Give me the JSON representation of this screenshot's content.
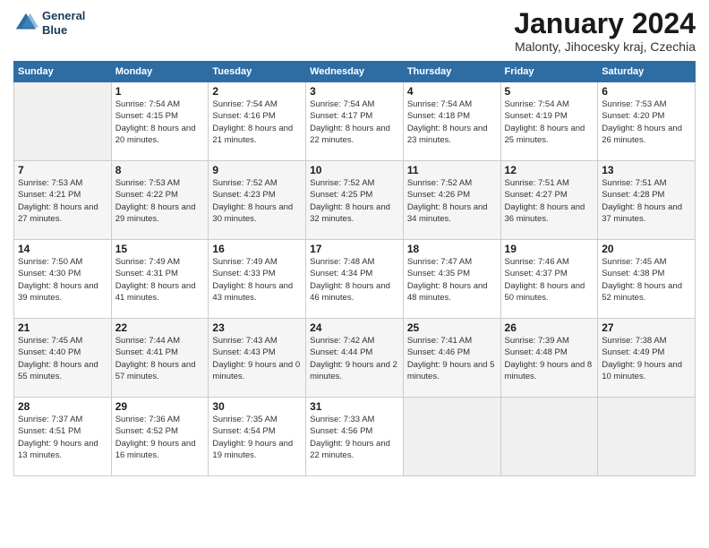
{
  "header": {
    "logo_line1": "General",
    "logo_line2": "Blue",
    "month": "January 2024",
    "location": "Malonty, Jihocesky kraj, Czechia"
  },
  "days_of_week": [
    "Sunday",
    "Monday",
    "Tuesday",
    "Wednesday",
    "Thursday",
    "Friday",
    "Saturday"
  ],
  "weeks": [
    [
      {
        "day": "",
        "sunrise": "",
        "sunset": "",
        "daylight": ""
      },
      {
        "day": "1",
        "sunrise": "Sunrise: 7:54 AM",
        "sunset": "Sunset: 4:15 PM",
        "daylight": "Daylight: 8 hours and 20 minutes."
      },
      {
        "day": "2",
        "sunrise": "Sunrise: 7:54 AM",
        "sunset": "Sunset: 4:16 PM",
        "daylight": "Daylight: 8 hours and 21 minutes."
      },
      {
        "day": "3",
        "sunrise": "Sunrise: 7:54 AM",
        "sunset": "Sunset: 4:17 PM",
        "daylight": "Daylight: 8 hours and 22 minutes."
      },
      {
        "day": "4",
        "sunrise": "Sunrise: 7:54 AM",
        "sunset": "Sunset: 4:18 PM",
        "daylight": "Daylight: 8 hours and 23 minutes."
      },
      {
        "day": "5",
        "sunrise": "Sunrise: 7:54 AM",
        "sunset": "Sunset: 4:19 PM",
        "daylight": "Daylight: 8 hours and 25 minutes."
      },
      {
        "day": "6",
        "sunrise": "Sunrise: 7:53 AM",
        "sunset": "Sunset: 4:20 PM",
        "daylight": "Daylight: 8 hours and 26 minutes."
      }
    ],
    [
      {
        "day": "7",
        "sunrise": "Sunrise: 7:53 AM",
        "sunset": "Sunset: 4:21 PM",
        "daylight": "Daylight: 8 hours and 27 minutes."
      },
      {
        "day": "8",
        "sunrise": "Sunrise: 7:53 AM",
        "sunset": "Sunset: 4:22 PM",
        "daylight": "Daylight: 8 hours and 29 minutes."
      },
      {
        "day": "9",
        "sunrise": "Sunrise: 7:52 AM",
        "sunset": "Sunset: 4:23 PM",
        "daylight": "Daylight: 8 hours and 30 minutes."
      },
      {
        "day": "10",
        "sunrise": "Sunrise: 7:52 AM",
        "sunset": "Sunset: 4:25 PM",
        "daylight": "Daylight: 8 hours and 32 minutes."
      },
      {
        "day": "11",
        "sunrise": "Sunrise: 7:52 AM",
        "sunset": "Sunset: 4:26 PM",
        "daylight": "Daylight: 8 hours and 34 minutes."
      },
      {
        "day": "12",
        "sunrise": "Sunrise: 7:51 AM",
        "sunset": "Sunset: 4:27 PM",
        "daylight": "Daylight: 8 hours and 36 minutes."
      },
      {
        "day": "13",
        "sunrise": "Sunrise: 7:51 AM",
        "sunset": "Sunset: 4:28 PM",
        "daylight": "Daylight: 8 hours and 37 minutes."
      }
    ],
    [
      {
        "day": "14",
        "sunrise": "Sunrise: 7:50 AM",
        "sunset": "Sunset: 4:30 PM",
        "daylight": "Daylight: 8 hours and 39 minutes."
      },
      {
        "day": "15",
        "sunrise": "Sunrise: 7:49 AM",
        "sunset": "Sunset: 4:31 PM",
        "daylight": "Daylight: 8 hours and 41 minutes."
      },
      {
        "day": "16",
        "sunrise": "Sunrise: 7:49 AM",
        "sunset": "Sunset: 4:33 PM",
        "daylight": "Daylight: 8 hours and 43 minutes."
      },
      {
        "day": "17",
        "sunrise": "Sunrise: 7:48 AM",
        "sunset": "Sunset: 4:34 PM",
        "daylight": "Daylight: 8 hours and 46 minutes."
      },
      {
        "day": "18",
        "sunrise": "Sunrise: 7:47 AM",
        "sunset": "Sunset: 4:35 PM",
        "daylight": "Daylight: 8 hours and 48 minutes."
      },
      {
        "day": "19",
        "sunrise": "Sunrise: 7:46 AM",
        "sunset": "Sunset: 4:37 PM",
        "daylight": "Daylight: 8 hours and 50 minutes."
      },
      {
        "day": "20",
        "sunrise": "Sunrise: 7:45 AM",
        "sunset": "Sunset: 4:38 PM",
        "daylight": "Daylight: 8 hours and 52 minutes."
      }
    ],
    [
      {
        "day": "21",
        "sunrise": "Sunrise: 7:45 AM",
        "sunset": "Sunset: 4:40 PM",
        "daylight": "Daylight: 8 hours and 55 minutes."
      },
      {
        "day": "22",
        "sunrise": "Sunrise: 7:44 AM",
        "sunset": "Sunset: 4:41 PM",
        "daylight": "Daylight: 8 hours and 57 minutes."
      },
      {
        "day": "23",
        "sunrise": "Sunrise: 7:43 AM",
        "sunset": "Sunset: 4:43 PM",
        "daylight": "Daylight: 9 hours and 0 minutes."
      },
      {
        "day": "24",
        "sunrise": "Sunrise: 7:42 AM",
        "sunset": "Sunset: 4:44 PM",
        "daylight": "Daylight: 9 hours and 2 minutes."
      },
      {
        "day": "25",
        "sunrise": "Sunrise: 7:41 AM",
        "sunset": "Sunset: 4:46 PM",
        "daylight": "Daylight: 9 hours and 5 minutes."
      },
      {
        "day": "26",
        "sunrise": "Sunrise: 7:39 AM",
        "sunset": "Sunset: 4:48 PM",
        "daylight": "Daylight: 9 hours and 8 minutes."
      },
      {
        "day": "27",
        "sunrise": "Sunrise: 7:38 AM",
        "sunset": "Sunset: 4:49 PM",
        "daylight": "Daylight: 9 hours and 10 minutes."
      }
    ],
    [
      {
        "day": "28",
        "sunrise": "Sunrise: 7:37 AM",
        "sunset": "Sunset: 4:51 PM",
        "daylight": "Daylight: 9 hours and 13 minutes."
      },
      {
        "day": "29",
        "sunrise": "Sunrise: 7:36 AM",
        "sunset": "Sunset: 4:52 PM",
        "daylight": "Daylight: 9 hours and 16 minutes."
      },
      {
        "day": "30",
        "sunrise": "Sunrise: 7:35 AM",
        "sunset": "Sunset: 4:54 PM",
        "daylight": "Daylight: 9 hours and 19 minutes."
      },
      {
        "day": "31",
        "sunrise": "Sunrise: 7:33 AM",
        "sunset": "Sunset: 4:56 PM",
        "daylight": "Daylight: 9 hours and 22 minutes."
      },
      {
        "day": "",
        "sunrise": "",
        "sunset": "",
        "daylight": ""
      },
      {
        "day": "",
        "sunrise": "",
        "sunset": "",
        "daylight": ""
      },
      {
        "day": "",
        "sunrise": "",
        "sunset": "",
        "daylight": ""
      }
    ]
  ]
}
